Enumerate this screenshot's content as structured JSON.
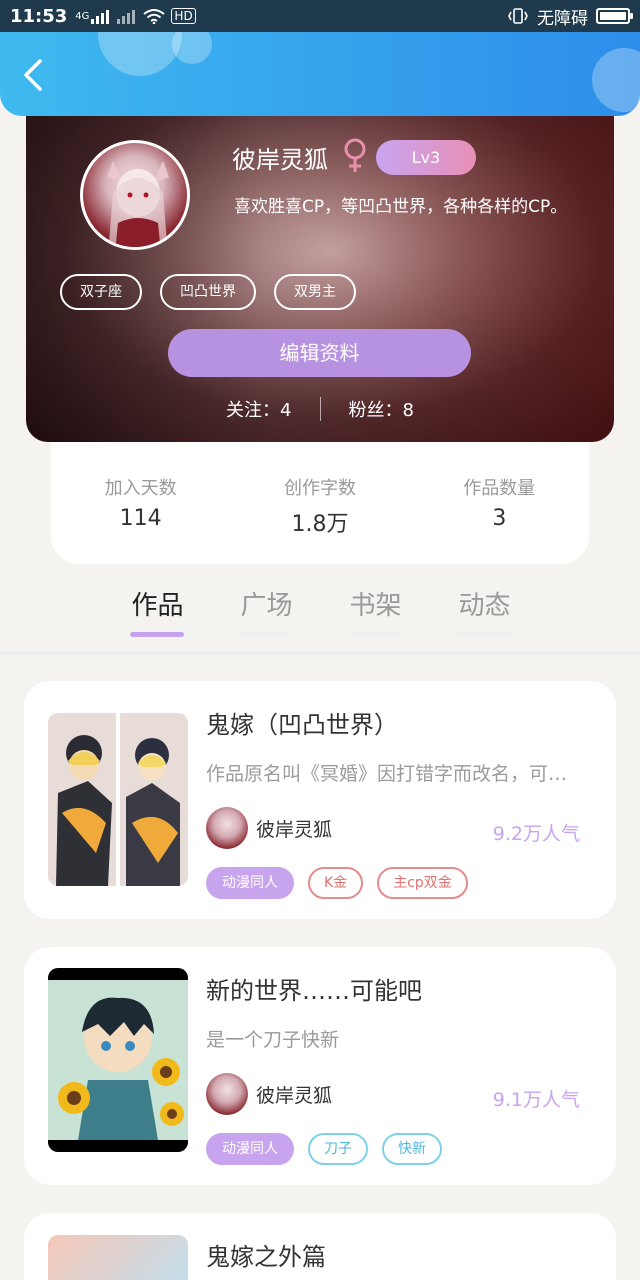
{
  "status_bar": {
    "time": "11:53",
    "network": "4G",
    "hd": "HD",
    "accessibility": "无障碍"
  },
  "header": {
    "back_icon": "chevron-left-icon"
  },
  "profile": {
    "name": "彼岸灵狐",
    "gender": "female",
    "level": "Lv3",
    "bio": "喜欢胜喜CP，等凹凸世界，各种各样的CP。",
    "tags": [
      "双子座",
      "凹凸世界",
      "双男主"
    ],
    "edit_label": "编辑资料",
    "follow_label": "关注：",
    "follow_count": "4",
    "fans_label": "粉丝：",
    "fans_count": "8"
  },
  "stats": [
    {
      "label": "加入天数",
      "value": "114"
    },
    {
      "label": "创作字数",
      "value": "1.8万"
    },
    {
      "label": "作品数量",
      "value": "3"
    }
  ],
  "tabs": [
    {
      "label": "作品",
      "active": true
    },
    {
      "label": "广场",
      "active": false
    },
    {
      "label": "书架",
      "active": false
    },
    {
      "label": "动态",
      "active": false
    }
  ],
  "works": [
    {
      "title": "鬼嫁（凹凸世界）",
      "desc": "作品原名叫《冥婚》因打错字而改名，可以说这是一个...",
      "author": "彼岸灵狐",
      "popularity": "9.2万人气",
      "tags": [
        {
          "label": "动漫同人",
          "style": "purple"
        },
        {
          "label": "K金",
          "style": "red"
        },
        {
          "label": "主cp双金",
          "style": "red"
        }
      ]
    },
    {
      "title": "新的世界……可能吧",
      "desc": "是一个刀子快新",
      "author": "彼岸灵狐",
      "popularity": "9.1万人气",
      "tags": [
        {
          "label": "动漫同人",
          "style": "purple"
        },
        {
          "label": "刀子",
          "style": "cyan"
        },
        {
          "label": "快新",
          "style": "cyan"
        }
      ]
    },
    {
      "title": "鬼嫁之外篇"
    }
  ],
  "colors": {
    "accent": "#c4a2ee",
    "header": "#2d8eea",
    "popularity": "#c9a4ee"
  }
}
